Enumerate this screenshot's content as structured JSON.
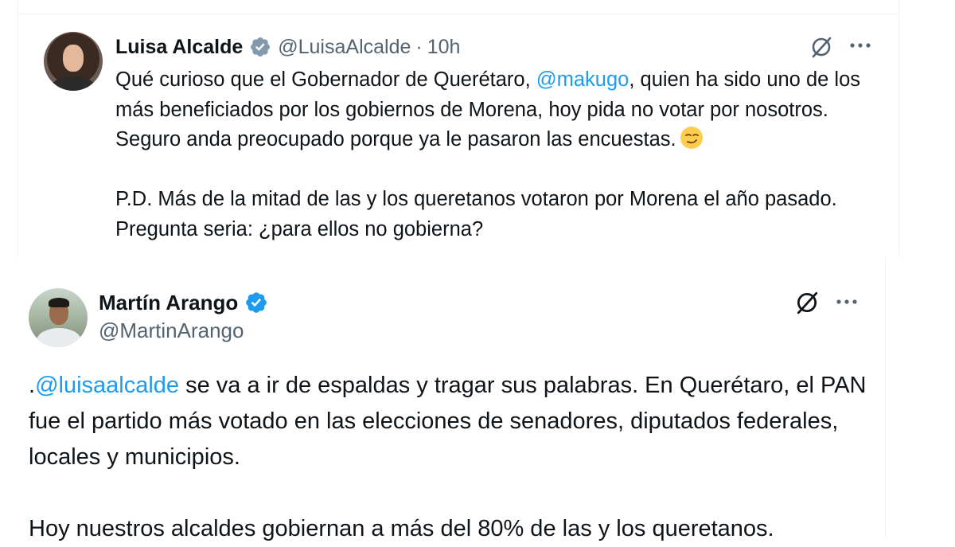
{
  "colors": {
    "link": "#1d9bf0",
    "secondary": "#536471",
    "verified": "#1d9bf0",
    "text": "#0f1419"
  },
  "tweet1": {
    "author_name": "Luisa Alcalde",
    "handle": "@LuisaAlcalde",
    "separator": "·",
    "time": "10h",
    "text_a": "Qué curioso que el Gobernador de Querétaro, ",
    "mention": "@makugo",
    "text_b": ", quien ha sido uno de los más beneficiados por los gobiernos de Morena, hoy pida no votar por nosotros. Seguro anda preocupado porque ya le pasaron las encuestas.",
    "emoji_icon": "smirking-face-icon",
    "text_c": "P.D. Más de la mitad de las y los queretanos votaron por Morena el año pasado. Pregunta seria: ¿para ellos no gobierna?"
  },
  "tweet2": {
    "author_name": "Martín Arango",
    "handle": "@MartinArango",
    "text_prefix": ".",
    "mention": "@luisaalcalde",
    "text_a": " se va a ir de espaldas y tragar sus palabras. En Querétaro, el PAN fue el partido más votado en las elecciones de senadores, diputados federales, locales y municipios.",
    "text_b": "Hoy nuestros alcaldes gobiernan a más del 80% de las y los queretanos."
  }
}
